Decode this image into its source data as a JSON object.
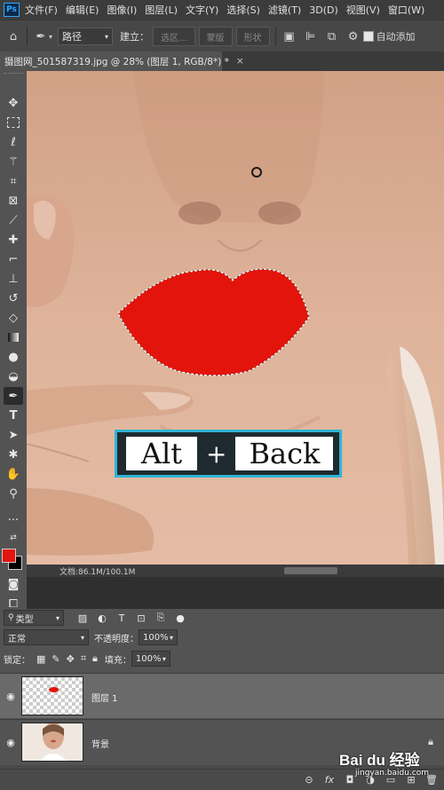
{
  "app": {
    "logo": "Ps"
  },
  "menu": [
    "文件(F)",
    "编辑(E)",
    "图像(I)",
    "图层(L)",
    "文字(Y)",
    "选择(S)",
    "滤镜(T)",
    "3D(D)",
    "视图(V)",
    "窗口(W)"
  ],
  "options": {
    "mode": "路径",
    "make_label": "建立：",
    "selection_btn": "选区...",
    "mask_btn": "蒙版",
    "shape_btn": "形状",
    "auto_add": "自动添加"
  },
  "document": {
    "tab_title": "摄图网_501587319.jpg @ 28% (图层 1, RGB/8*) *",
    "close": "×",
    "status": "文档:86.1M/100.1M"
  },
  "overlay": {
    "key1": "Alt",
    "plus": "+",
    "key2": "Back",
    "border_color": "#2fb4d4",
    "lip_color": "#e3140c"
  },
  "colors": {
    "foreground": "#e3140c",
    "background": "#000000"
  },
  "layers_panel": {
    "kind_filter": "类型",
    "blend_mode": "正常",
    "opacity_label": "不透明度：",
    "opacity_value": "100%",
    "lock_label": "锁定：",
    "fill_label": "填充：",
    "fill_value": "100%",
    "layers": [
      {
        "name": "图层 1",
        "selected": true
      },
      {
        "name": "背景",
        "selected": false
      }
    ]
  },
  "watermark": {
    "brand": "Bai du 经验",
    "url": "jingyan.baidu.com"
  }
}
